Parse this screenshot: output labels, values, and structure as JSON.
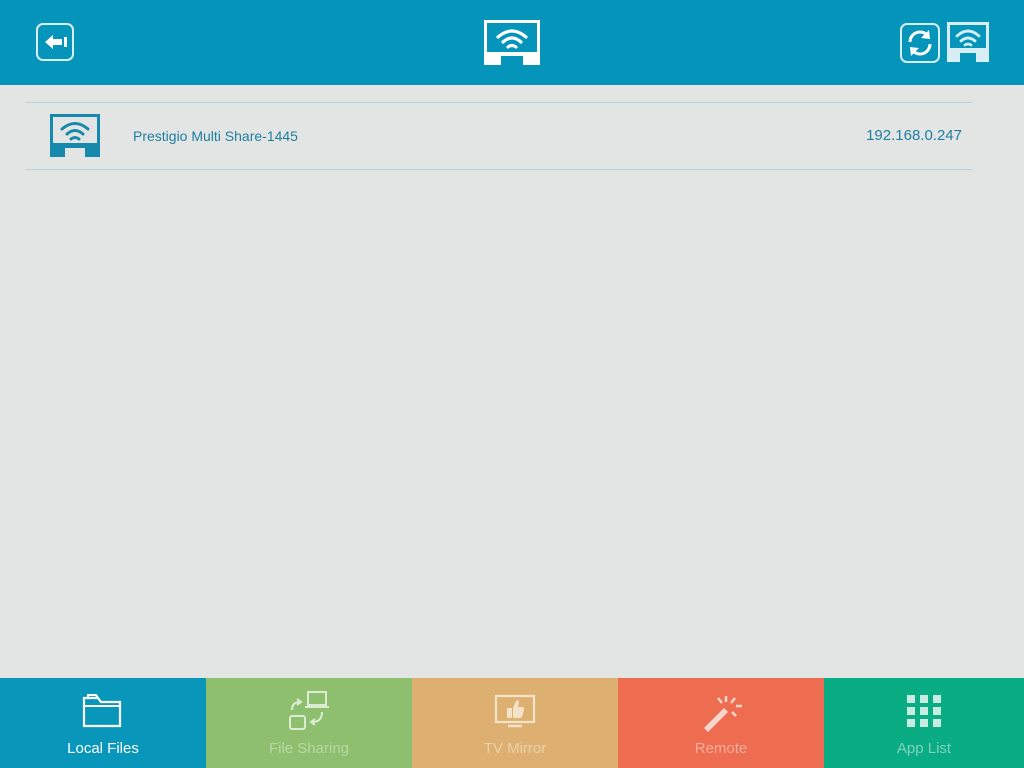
{
  "header": {
    "back_icon": "back-arrow-icon",
    "logo_icon": "wifi-cast-icon",
    "refresh_icon": "refresh-icon",
    "cast_icon": "wifi-cast-icon"
  },
  "devices": [
    {
      "icon": "wifi-cast-icon",
      "name": "Prestigio Multi Share-1445",
      "ip": "192.168.0.247"
    }
  ],
  "tabs": [
    {
      "label": "Local Files",
      "icon": "folder-icon",
      "bg": "#0896bb",
      "fg": "#ffffff",
      "selected": true
    },
    {
      "label": "File Sharing",
      "icon": "file-sharing-icon",
      "bg": "#8dbf6f",
      "fg": "#b7d9a4",
      "selected": false
    },
    {
      "label": "TV Mirror",
      "icon": "tv-mirror-icon",
      "bg": "#ddb072",
      "fg": "#ecd1a8",
      "selected": false
    },
    {
      "label": "Remote",
      "icon": "magic-wand-icon",
      "bg": "#ee6c50",
      "fg": "#f6ad9b",
      "selected": false
    },
    {
      "label": "App List",
      "icon": "grid-icon",
      "bg": "#0aac84",
      "fg": "#7fd2bc",
      "selected": false
    }
  ],
  "colors": {
    "header_bg": "#0595bb",
    "content_bg": "#e3e5e5",
    "accent_text": "#1e7fa0"
  }
}
